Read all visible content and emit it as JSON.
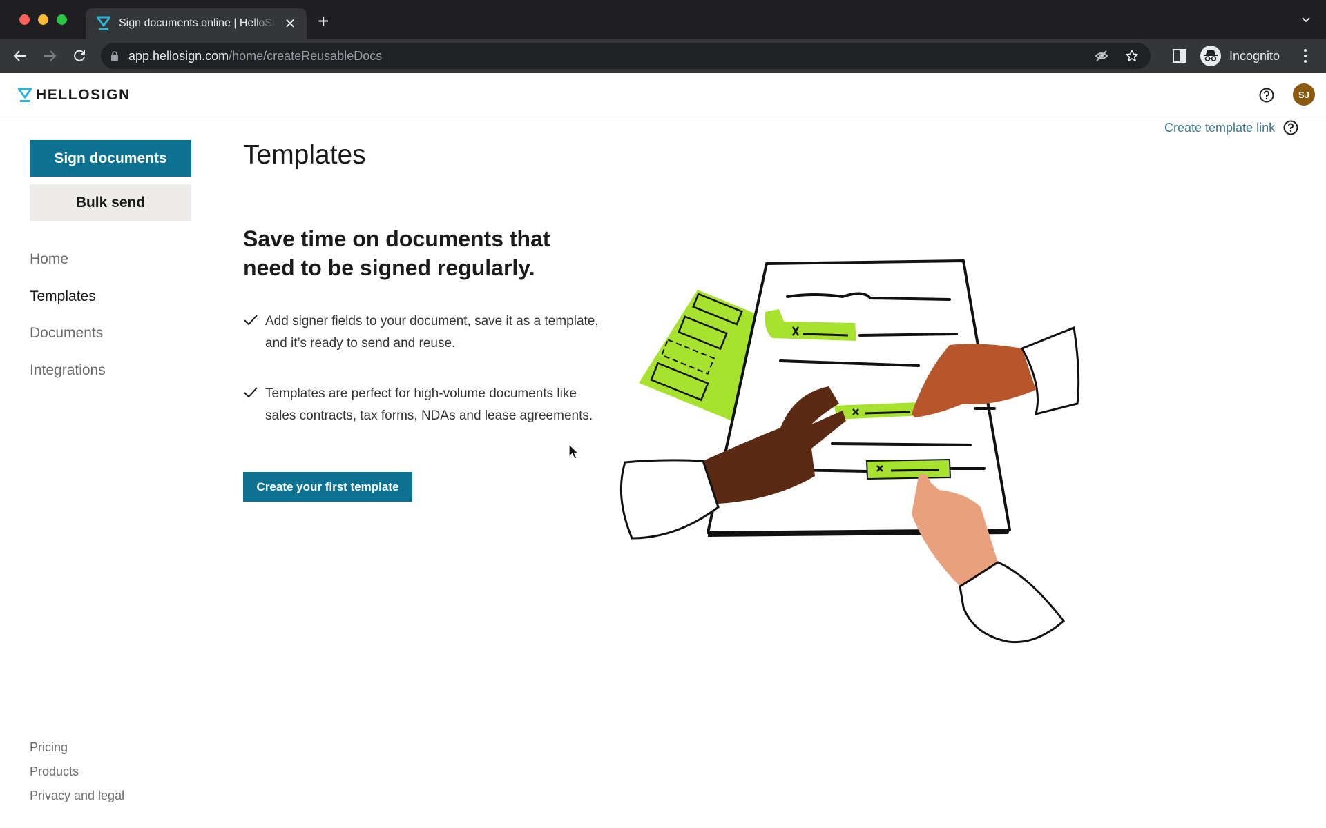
{
  "browser": {
    "tab_title": "Sign documents online | HelloSign",
    "url_host": "app.hellosign.com",
    "url_path": "/home/createReusableDocs",
    "profile_label": "Incognito",
    "icons": [
      "back-icon",
      "forward-icon",
      "reload-icon",
      "lock-icon",
      "eye-off-icon",
      "star-icon",
      "side-panel-icon",
      "incognito-icon",
      "kebab-menu-icon"
    ]
  },
  "header": {
    "logo_text": "HELLOSIGN",
    "avatar_initials": "SJ",
    "avatar_color": "#8a5a0f",
    "help_icon": "help-circle-icon"
  },
  "sidebar": {
    "primary_button": "Sign documents",
    "secondary_button": "Bulk send",
    "nav": [
      {
        "label": "Home",
        "active": false
      },
      {
        "label": "Templates",
        "active": true
      },
      {
        "label": "Documents",
        "active": false
      },
      {
        "label": "Integrations",
        "active": false
      }
    ],
    "footer": [
      "Pricing",
      "Products",
      "Privacy and legal"
    ]
  },
  "main": {
    "title": "Templates",
    "template_link": "Create template link",
    "headline": "Save time on documents that need to be signed regularly.",
    "bullets": [
      "Add signer fields to your document, save it as a template, and it’s ready to send and reuse.",
      "Templates are perfect for high-volume documents like sales contracts, tax forms, NDAs and lease agreements."
    ],
    "cta_button": "Create your first template",
    "illustration": "hands-placing-signature-fields-on-document"
  },
  "colors": {
    "brand_primary": "#0d7191",
    "brand_logo": "#29b6d8",
    "accent_green": "#a6e22e",
    "secondary_button_bg": "#eeece9"
  }
}
